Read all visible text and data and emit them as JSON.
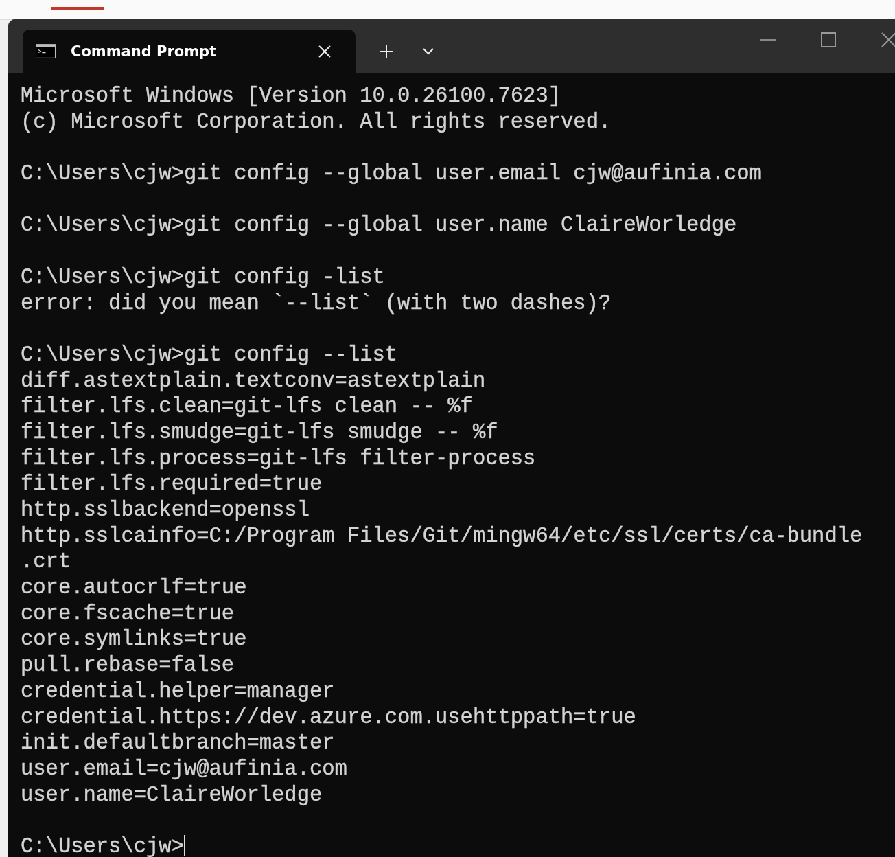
{
  "window": {
    "tabs": [
      {
        "title": "Command Prompt",
        "selected": true
      }
    ]
  },
  "console": {
    "blocks": [
      {
        "lines": [
          "Microsoft Windows [Version 10.0.26100.7623]",
          "(c) Microsoft Corporation. All rights reserved."
        ]
      },
      {
        "lines": [
          "C:\\Users\\cjw>git config --global user.email cjw@aufinia.com"
        ]
      },
      {
        "lines": [
          "C:\\Users\\cjw>git config --global user.name ClaireWorledge"
        ]
      },
      {
        "lines": [
          "C:\\Users\\cjw>git config -list",
          "error: did you mean `--list` (with two dashes)?"
        ]
      },
      {
        "lines": [
          "C:\\Users\\cjw>git config --list",
          "diff.astextplain.textconv=astextplain",
          "filter.lfs.clean=git-lfs clean -- %f",
          "filter.lfs.smudge=git-lfs smudge -- %f",
          "filter.lfs.process=git-lfs filter-process",
          "filter.lfs.required=true",
          "http.sslbackend=openssl",
          "http.sslcainfo=C:/Program Files/Git/mingw64/etc/ssl/certs/ca-bundle",
          ".crt",
          "core.autocrlf=true",
          "core.fscache=true",
          "core.symlinks=true",
          "pull.rebase=false",
          "credential.helper=manager",
          "credential.https://dev.azure.com.usehttppath=true",
          "init.defaultbranch=master",
          "user.email=cjw@aufinia.com",
          "user.name=ClaireWorledge"
        ]
      },
      {
        "lines": [
          "C:\\Users\\cjw>"
        ]
      }
    ],
    "cursor_visible": true
  }
}
